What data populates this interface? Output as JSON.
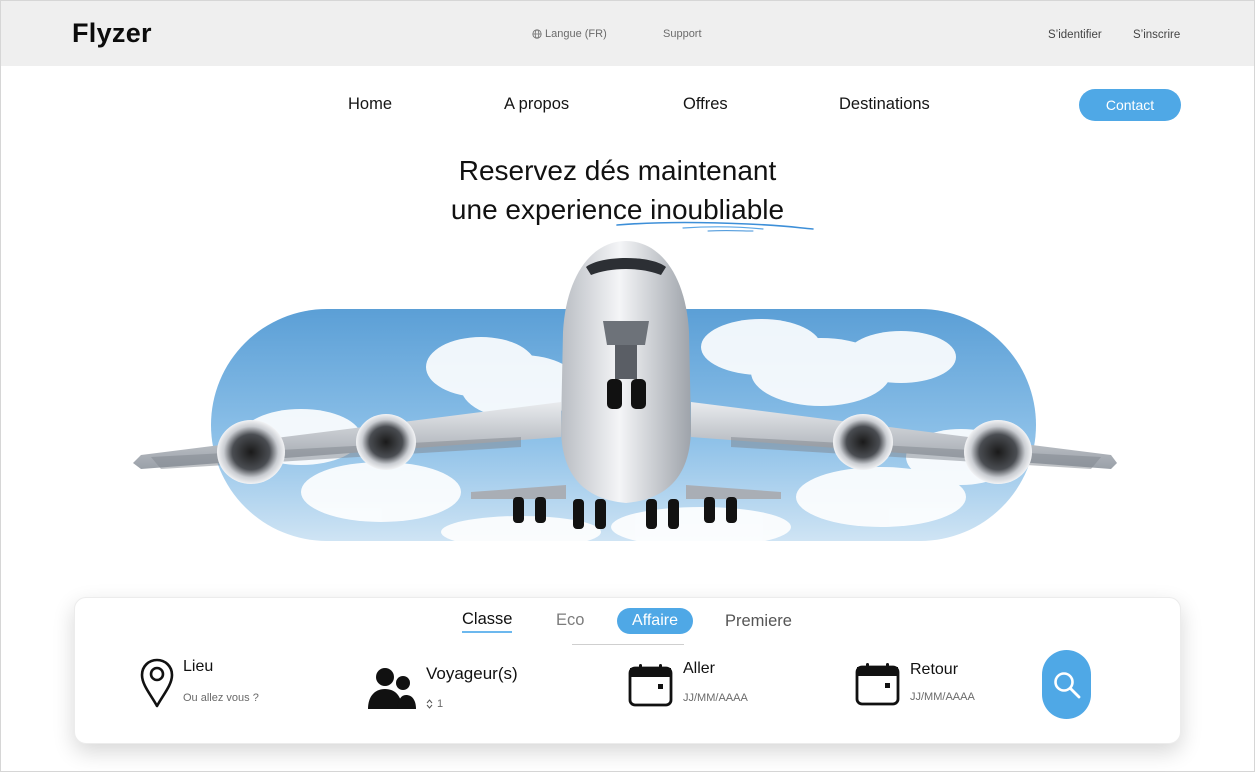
{
  "brand": {
    "logo": "Flyzer",
    "accent_color": "#4fa8e6"
  },
  "topbar": {
    "language_label": "Langue (FR)",
    "language_icon": "globe-icon",
    "support_label": "Support",
    "login_label": "S’identifier",
    "signup_label": "S’inscrire"
  },
  "nav": {
    "items": [
      "Home",
      "A propos",
      "Offres",
      "Destinations"
    ],
    "contact_label": "Contact"
  },
  "hero": {
    "title_line1": "Reservez dés maintenant",
    "title_line2": "une experience inoubliable",
    "image": "airplane-in-sky-image"
  },
  "booking": {
    "class_label": "Classe",
    "classes": [
      "Eco",
      "Affaire",
      "Premiere"
    ],
    "selected_class": "Affaire",
    "fields": {
      "place": {
        "label": "Lieu",
        "placeholder": "Ou allez vous ?",
        "icon": "map-pin-icon"
      },
      "travelers": {
        "label": "Voyageur(s)",
        "value": "1",
        "icon": "users-icon"
      },
      "departure": {
        "label": "Aller",
        "placeholder": "JJ/MM/AAAA",
        "icon": "calendar-icon"
      },
      "return": {
        "label": "Retour",
        "placeholder": "JJ/MM/AAAA",
        "icon": "calendar-icon"
      }
    },
    "search_icon": "search-icon"
  }
}
